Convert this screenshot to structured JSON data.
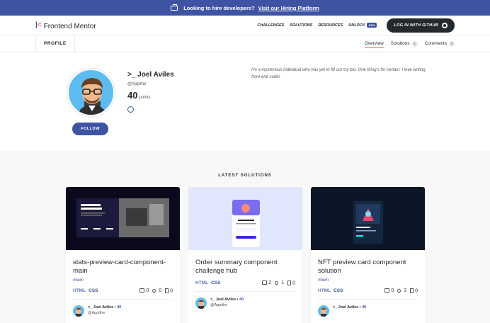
{
  "banner": {
    "text": "Looking to hire developers?",
    "link": "Visit our Hiring Platform"
  },
  "nav": {
    "logo_text": "Frontend Mentor",
    "links": [
      "CHALLENGES",
      "SOLUTIONS",
      "RESOURCES",
      "UNLOCK"
    ],
    "pro_badge": "PRO",
    "login_label": "LOG IN WITH GITHUB"
  },
  "subnav": {
    "profile_tab": "PROFILE",
    "tabs": [
      {
        "label": "Overview",
        "count": ""
      },
      {
        "label": "Solutions",
        "count": "4"
      },
      {
        "label": "Comments",
        "count": "0"
      }
    ]
  },
  "profile": {
    "name": ">_ Joel Aviles",
    "handle": "@Appithe",
    "points": "40",
    "points_label": "points",
    "follow_label": "FOLLOW",
    "bio": "I'm a mysterious individual who has yet to fill out my bio. One thing's for certain: I love writing front-end code!"
  },
  "latest": {
    "title": "LATEST SOLUTIONS",
    "cards": [
      {
        "title": "stats-preview-card-component-main",
        "tag": "#bem",
        "html": "HTML",
        "css": "CSS",
        "comments": "0",
        "likes": "0",
        "bookmarks": "0",
        "author": ">_ Joel Aviles",
        "points": "40",
        "handle": "@Appithe"
      },
      {
        "title": "Order summary component challenge hub",
        "tag": "",
        "html": "HTML",
        "css": "CSS",
        "comments": "2",
        "likes": "1",
        "bookmarks": "0",
        "author": ">_ Joel Aviles",
        "points": "40",
        "handle": "@Appithe"
      },
      {
        "title": "NFT preview card component solution",
        "tag": "#bem",
        "html": "HTML",
        "css": "CSS",
        "comments": "0",
        "likes": "3",
        "bookmarks": "0",
        "author": ">_ Joel Aviles",
        "points": "40",
        "handle": ""
      }
    ]
  },
  "colors": {
    "accent": "#3e54a3",
    "brand_red": "#ed6b5c",
    "dark": "#24292e"
  }
}
